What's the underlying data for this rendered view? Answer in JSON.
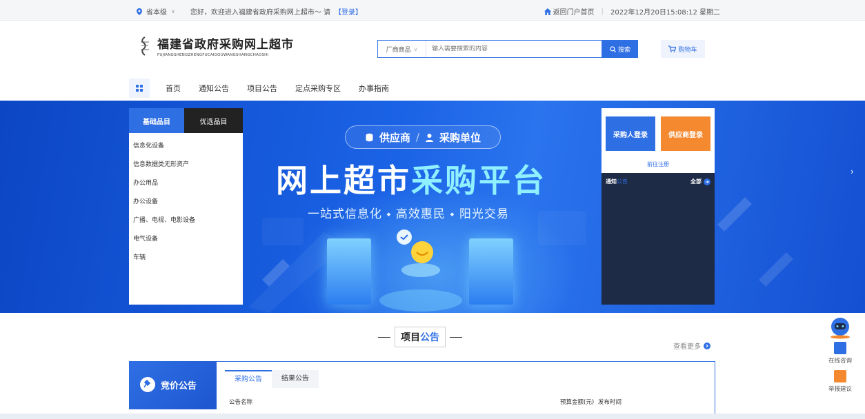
{
  "topbar": {
    "region": "省本级",
    "welcome": "您好，欢迎进入福建省政府采购网上超市～ 请",
    "login_link": "【登录】",
    "portal_link": "返回门户首页",
    "datetime": "2022年12月20日15:08:12 星期二"
  },
  "header": {
    "site_title": "福建省政府采购网上超市",
    "site_pinyin": "FUJIANGSHENGZHENGFUCAIGOUWANGSHANGCHAOSHI",
    "search_scope": "厂商商品",
    "search_placeholder": "输入需要搜索的内容",
    "search_button": "搜索",
    "cart_button": "购物车"
  },
  "nav": {
    "items": [
      "首页",
      "通知公告",
      "项目公告",
      "定点采购专区",
      "办事指南"
    ]
  },
  "banner": {
    "pill_left": "供应商",
    "pill_sep": "/",
    "pill_right": "采购单位",
    "headline_a": "网上超市",
    "headline_b": "采购平台",
    "subline": "一站式信息化 ⬩ 高效惠民 ⬩ 阳光交易"
  },
  "categories": {
    "tab_active": "基础品目",
    "tab_other": "优选品目",
    "items": [
      "信息化设备",
      "信息数据类无形资产",
      "办公用品",
      "办公设备",
      "广播、电视、电影设备",
      "电气设备",
      "车辆"
    ]
  },
  "login": {
    "buyer_login": "采购人登录",
    "supplier_login": "供应商登录",
    "register": "前往注册",
    "notice_prefix": "通知",
    "notice_title": "公告",
    "all": "全部"
  },
  "section": {
    "title_a": "项目",
    "title_b": "公告",
    "more": "查看更多",
    "left_card": "竞价公告",
    "tabs": [
      "采购公告",
      "结果公告"
    ],
    "col_name": "公告名称",
    "col_budget": "预算金额(元)",
    "col_time": "发布时间"
  },
  "float": {
    "consult": "在线咨询",
    "report": "举报建议"
  },
  "colors": {
    "primary": "#2f6fe4",
    "orange": "#f5892f",
    "dark_panel": "#1d2b47"
  }
}
